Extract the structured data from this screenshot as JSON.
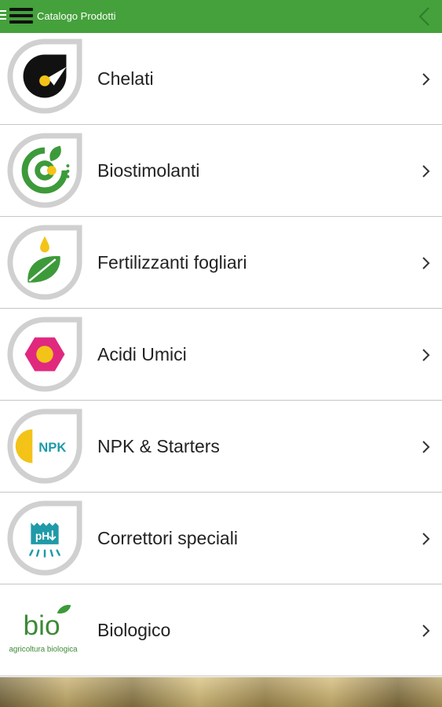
{
  "app_bar": {
    "title": "Catalogo Prodotti",
    "menu_icon": "hamburger-icon",
    "back_icon": "chevron-left-icon",
    "background": "#44a13b"
  },
  "categories": [
    {
      "label": "Chelati",
      "icon": "chelati-icon"
    },
    {
      "label": "Biostimolanti",
      "icon": "biostimolanti-icon"
    },
    {
      "label": "Fertilizzanti fogliari",
      "icon": "leaf-drop-icon"
    },
    {
      "label": "Acidi Umici",
      "icon": "hexagon-icon"
    },
    {
      "label": "NPK & Starters",
      "icon": "npk-icon",
      "icon_text": "NPK"
    },
    {
      "label": "Correttori speciali",
      "icon": "ph-icon",
      "icon_text": "pH"
    },
    {
      "label": "Biologico",
      "icon": "bio-logo",
      "logo_text": "bio",
      "logo_subtext": "agricoltura biologica"
    }
  ],
  "row_chevron_icon": "chevron-right-icon"
}
